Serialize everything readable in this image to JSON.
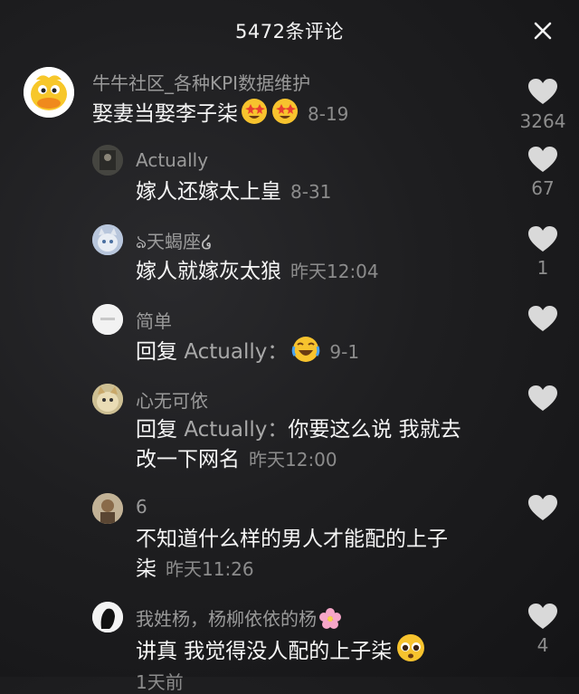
{
  "header": {
    "title": "5472条评论"
  },
  "comments": [
    {
      "name": "牛牛社区_各种KPI数据维护",
      "text": "娶妻当娶李子柒",
      "time": "8-19",
      "likes": "3264"
    },
    {
      "name": "Actually",
      "text": "嫁人还嫁太上皇",
      "time": "8-31",
      "likes": "67"
    },
    {
      "name": "天蝎座",
      "text": "嫁人就嫁灰太狼",
      "time": "昨天12:04",
      "likes": "1"
    },
    {
      "name": "简单",
      "reply_prefix": "回复 ",
      "reply_to": "Actually：",
      "time": "9-1",
      "likes": ""
    },
    {
      "name": "心无可依",
      "reply_prefix": "回复 ",
      "reply_to": "Actually：",
      "text_line1": "你要这么说 我就去",
      "text_line2": "改一下网名",
      "time": "昨天12:00",
      "likes": ""
    },
    {
      "name": "6",
      "text_line1": "不知道什么样的男人才能配的上子",
      "text_line2": "柒",
      "time": "昨天11:26",
      "likes": ""
    },
    {
      "name": "我姓杨，杨柳依依的杨",
      "text": "讲真 我觉得没人配的上子柒",
      "time": "1天前",
      "likes": "4"
    }
  ]
}
